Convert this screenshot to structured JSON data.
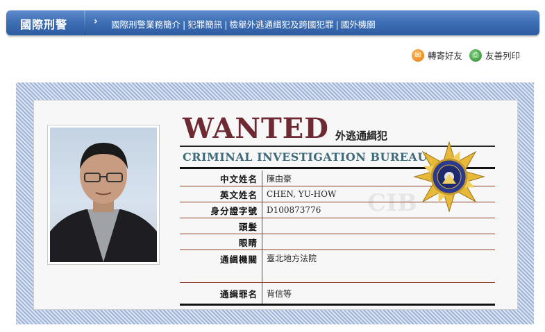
{
  "nav": {
    "title": "國際刑警",
    "arrow": "›",
    "links": [
      "國際刑警業務簡介",
      "犯罪簡訊",
      "檢舉外逃通緝犯及跨國犯罪",
      "國外機關"
    ],
    "divider": "|"
  },
  "tools": {
    "forward_label": "轉寄好友",
    "print_label": "友善列印"
  },
  "poster": {
    "heading": "WANTED",
    "subheading": "外逃通緝犯",
    "agency": "CRIMINAL INVESTIGATION BUREAU",
    "watermark": "CIB",
    "rows": [
      {
        "label": "中文姓名",
        "value": "陳由豪"
      },
      {
        "label": "英文姓名",
        "value": "CHEN, YU-HOW"
      },
      {
        "label": "身分證字號",
        "value": "D100873776"
      },
      {
        "label": "頭髮",
        "value": ""
      },
      {
        "label": "眼睛",
        "value": ""
      },
      {
        "label": "通緝機關",
        "value": "臺北地方法院"
      },
      {
        "label": "通緝罪名",
        "value": "背信等"
      }
    ]
  },
  "colors": {
    "nav_bg": "#3f6fb5",
    "wanted_text": "#6e2a33",
    "agency_text": "#3f6a7a",
    "rule": "#8a3b22"
  }
}
